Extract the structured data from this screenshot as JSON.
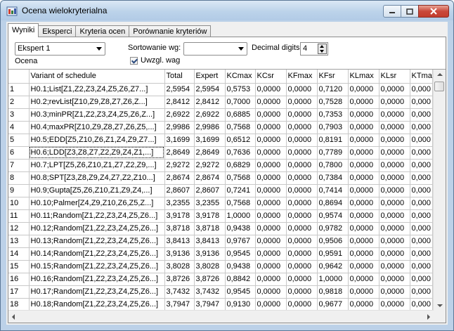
{
  "window": {
    "title": "Ocena wielokryterialna"
  },
  "tabs": [
    "Wyniki",
    "Eksperci",
    "Kryteria ocen",
    "Porównanie kryteriów"
  ],
  "controls": {
    "expert_select": "Ekspert 1",
    "ocena_label": "Ocena",
    "sort_label": "Sortowanie wg:",
    "sort_value": "",
    "weights_label": "Uwzgl. wag",
    "decimal_label": "Decimal digits",
    "decimal_value": "4"
  },
  "table": {
    "columns": [
      "",
      "Variant of schedule",
      "Total",
      "Expert",
      "KCmax",
      "KCsr",
      "KFmax",
      "KFsr",
      "KLmax",
      "KLsr",
      "KTma"
    ],
    "rows": [
      [
        "1",
        "H0.1;List[Z1,Z2,Z3,Z4,Z5,Z6,Z7...]",
        "2,5954",
        "2,5954",
        "0,5753",
        "0,0000",
        "0,0000",
        "0,7120",
        "0,0000",
        "0,0000",
        "0,000"
      ],
      [
        "2",
        "H0.2;revList[Z10,Z9,Z8,Z7,Z6,Z...]",
        "2,8412",
        "2,8412",
        "0,7000",
        "0,0000",
        "0,0000",
        "0,7528",
        "0,0000",
        "0,0000",
        "0,000"
      ],
      [
        "3",
        "H0.3;minPR[Z1,Z2,Z3,Z4,Z5,Z6,Z...]",
        "2,6922",
        "2,6922",
        "0,6885",
        "0,0000",
        "0,0000",
        "0,7353",
        "0,0000",
        "0,0000",
        "0,000"
      ],
      [
        "4",
        "H0.4;maxPR[Z10,Z9,Z8,Z7,Z6,Z5,...]",
        "2,9986",
        "2,9986",
        "0,7568",
        "0,0000",
        "0,0000",
        "0,7903",
        "0,0000",
        "0,0000",
        "0,000"
      ],
      [
        "5",
        "H0.5;EDD[Z5,Z10,Z6,Z1,Z4,Z9,Z7...]",
        "3,1699",
        "3,1699",
        "0,6512",
        "0,0000",
        "0,0000",
        "0,8191",
        "0,0000",
        "0,0000",
        "0,000"
      ],
      [
        "6",
        "H0.6;LDD[Z3,Z8,Z7,Z2,Z9,Z4,Z1,...]",
        "2,8649",
        "2,8649",
        "0,7636",
        "0,0000",
        "0,0000",
        "0,7789",
        "0,0000",
        "0,0000",
        "0,000"
      ],
      [
        "7",
        "H0.7;LPT[Z5,Z6,Z10,Z1,Z7,Z2,Z9,...]",
        "2,9272",
        "2,9272",
        "0,6829",
        "0,0000",
        "0,0000",
        "0,7800",
        "0,0000",
        "0,0000",
        "0,000"
      ],
      [
        "8",
        "H0.8;SPT[Z3,Z8,Z9,Z4,Z7,Z2,Z10...]",
        "2,8674",
        "2,8674",
        "0,7568",
        "0,0000",
        "0,0000",
        "0,7384",
        "0,0000",
        "0,0000",
        "0,000"
      ],
      [
        "9",
        "H0.9;Gupta[Z5,Z6,Z10,Z1,Z9,Z4,...]",
        "2,8607",
        "2,8607",
        "0,7241",
        "0,0000",
        "0,0000",
        "0,7414",
        "0,0000",
        "0,0000",
        "0,000"
      ],
      [
        "10",
        "H0.10;Palmer[Z4,Z9,Z10,Z6,Z5,Z...]",
        "3,2355",
        "3,2355",
        "0,7568",
        "0,0000",
        "0,0000",
        "0,8694",
        "0,0000",
        "0,0000",
        "0,000"
      ],
      [
        "11",
        "H0.11;Random[Z1,Z2,Z3,Z4,Z5,Z6...]",
        "3,9178",
        "3,9178",
        "1,0000",
        "0,0000",
        "0,0000",
        "0,9574",
        "0,0000",
        "0,0000",
        "0,000"
      ],
      [
        "12",
        "H0.12;Random[Z1,Z2,Z3,Z4,Z5,Z6...]",
        "3,8718",
        "3,8718",
        "0,9438",
        "0,0000",
        "0,0000",
        "0,9782",
        "0,0000",
        "0,0000",
        "0,000"
      ],
      [
        "13",
        "H0.13;Random[Z1,Z2,Z3,Z4,Z5,Z6...]",
        "3,8413",
        "3,8413",
        "0,9767",
        "0,0000",
        "0,0000",
        "0,9506",
        "0,0000",
        "0,0000",
        "0,000"
      ],
      [
        "14",
        "H0.14;Random[Z1,Z2,Z3,Z4,Z5,Z6...]",
        "3,9136",
        "3,9136",
        "0,9545",
        "0,0000",
        "0,0000",
        "0,9591",
        "0,0000",
        "0,0000",
        "0,000"
      ],
      [
        "15",
        "H0.15;Random[Z1,Z2,Z3,Z4,Z5,Z6...]",
        "3,8028",
        "3,8028",
        "0,9438",
        "0,0000",
        "0,0000",
        "0,9642",
        "0,0000",
        "0,0000",
        "0,000"
      ],
      [
        "16",
        "H0.16;Random[Z1,Z2,Z3,Z4,Z5,Z6...]",
        "3,8726",
        "3,8726",
        "0,8842",
        "0,0000",
        "0,0000",
        "1,0000",
        "0,0000",
        "0,0000",
        "0,000"
      ],
      [
        "17",
        "H0.17;Random[Z1,Z2,Z3,Z4,Z5,Z6...]",
        "3,7432",
        "3,7432",
        "0,9545",
        "0,0000",
        "0,0000",
        "0,9818",
        "0,0000",
        "0,0000",
        "0,000"
      ],
      [
        "18",
        "H0.18;Random[Z1,Z2,Z3,Z4,Z5,Z6...]",
        "3,7947",
        "3,7947",
        "0,9130",
        "0,0000",
        "0,0000",
        "0,9677",
        "0,0000",
        "0,0000",
        "0,000"
      ]
    ],
    "selected_row": 6
  }
}
